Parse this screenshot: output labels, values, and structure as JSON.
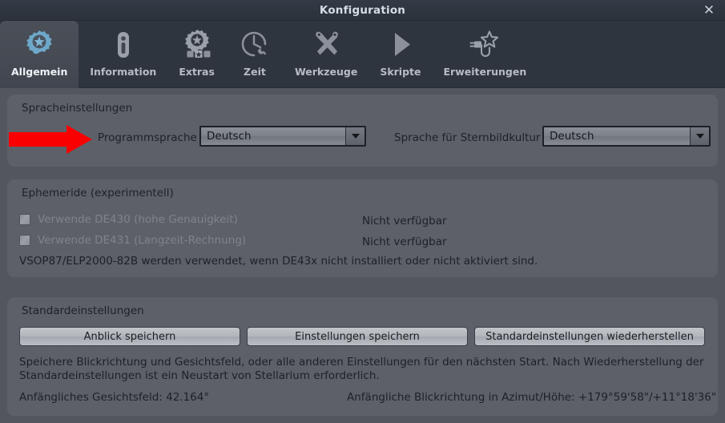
{
  "window": {
    "title": "Konfiguration",
    "close_label": "✕"
  },
  "tabs": [
    {
      "label": "Allgemein",
      "icon": "gear-star-icon",
      "active": true
    },
    {
      "label": "Information",
      "icon": "info-icon",
      "active": false
    },
    {
      "label": "Extras",
      "icon": "gear-blocks-icon",
      "active": false
    },
    {
      "label": "Zeit",
      "icon": "clock-wrench-icon",
      "active": false
    },
    {
      "label": "Werkzeuge",
      "icon": "tools-icon",
      "active": false
    },
    {
      "label": "Skripte",
      "icon": "play-icon",
      "active": false
    },
    {
      "label": "Erweiterungen",
      "icon": "plugin-star-icon",
      "active": false
    }
  ],
  "language_group": {
    "title": "Spracheinstellungen",
    "program_language": {
      "label": "Programmsprache",
      "value": "Deutsch"
    },
    "sky_culture_language": {
      "label": "Sprache für Sternbildkultur",
      "value": "Deutsch"
    }
  },
  "ephemeris_group": {
    "title": "Ephemeride (experimentell)",
    "rows": [
      {
        "label": "Verwende DE430 (hohe Genauigkeit)",
        "checked": false,
        "status": "Nicht verfügbar"
      },
      {
        "label": "Verwende DE431 (Langzeit-Rechnung)",
        "checked": false,
        "status": "Nicht verfügbar"
      }
    ],
    "note": "VSOP87/ELP2000-82B werden verwendet, wenn DE43x nicht installiert oder nicht aktiviert sind."
  },
  "defaults_group": {
    "title": "Standardeinstellungen",
    "buttons": [
      {
        "label": "Anblick speichern"
      },
      {
        "label": "Einstellungen speichern"
      },
      {
        "label": "Standardeinstellungen wiederherstellen"
      }
    ],
    "description_line1": "Speichere Blickrichtung und Gesichtsfeld, oder alle anderen Einstellungen für den nächsten Start. Nach Wiederherstellung der",
    "description_line2": "Standardeinstellungen ist ein Neustart von Stellarium erforderlich.",
    "fov_text": "Anfängliches Gesichtsfeld: 42.164°",
    "view_direction_text": "Anfängliche Blickrichtung in Azimut/Höhe: +179°59'58\"/+11°18'36\""
  },
  "annotation": {
    "arrow_color": "#fa0000",
    "points_at": "Programmsprache"
  },
  "colors": {
    "titlebar": "#2e353f",
    "tabbar": "#2f353e",
    "dialog_background": "#53565d",
    "group_background": "#5d6068",
    "active_tab_icon": "#6ea8c9"
  }
}
